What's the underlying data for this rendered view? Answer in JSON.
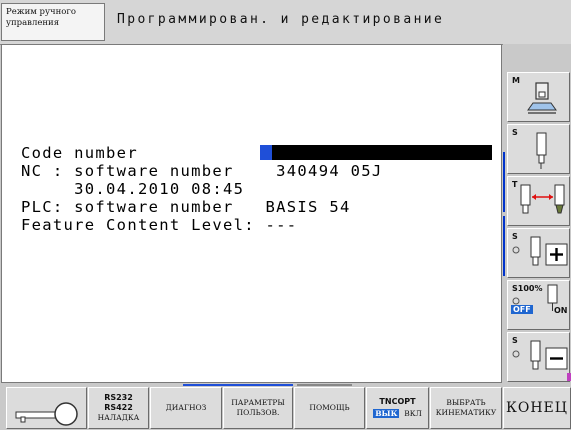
{
  "header": {
    "mode_label": "Режим ручного\nуправления",
    "title": "Программирован. и редактирование"
  },
  "screen": {
    "line_code_label": "Code number",
    "line_nc": "NC : software number    340494 05J",
    "line_nc_date": "     30.04.2010 08:45",
    "line_plc": "PLC: software number   BASIS 54",
    "line_feature": "Feature Content Level: ---"
  },
  "right_softkeys": [
    {
      "label": "M",
      "icon": "machine-table-icon"
    },
    {
      "label": "S",
      "icon": "spindle-icon"
    },
    {
      "label": "T",
      "icon": "tool-change-icon"
    },
    {
      "label": "S",
      "icon": "spindle-plus-icon",
      "sign": "+"
    },
    {
      "label": "S100%",
      "icon": "spindle-override-icon",
      "off": "OFF",
      "on": "ON"
    },
    {
      "label": "S",
      "icon": "spindle-minus-icon",
      "sign": "−"
    }
  ],
  "bottom_softkeys": {
    "key_icon": "key-icon",
    "rs_line1": "RS232",
    "rs_line2": "RS422",
    "rs_line3": "НАЛАДКА",
    "diag": "ДИАГНОЗ",
    "params_line1": "ПАРАМЕТРЫ",
    "params_line2": "ПОЛЬЗОВ.",
    "help": "ПОМОЩЬ",
    "tncopt_line1": "TNCOPT",
    "tncopt_off": "ВЫК",
    "tncopt_on": "ВКЛ",
    "kin_line1": "ВЫБРАТЬ",
    "kin_line2": "КИНЕМАТИКУ",
    "end": "КОНЕЦ"
  },
  "colors": {
    "accent": "#1f4fd8",
    "screen_bg": "#ffffff",
    "chrome": "#c9c9c9"
  }
}
